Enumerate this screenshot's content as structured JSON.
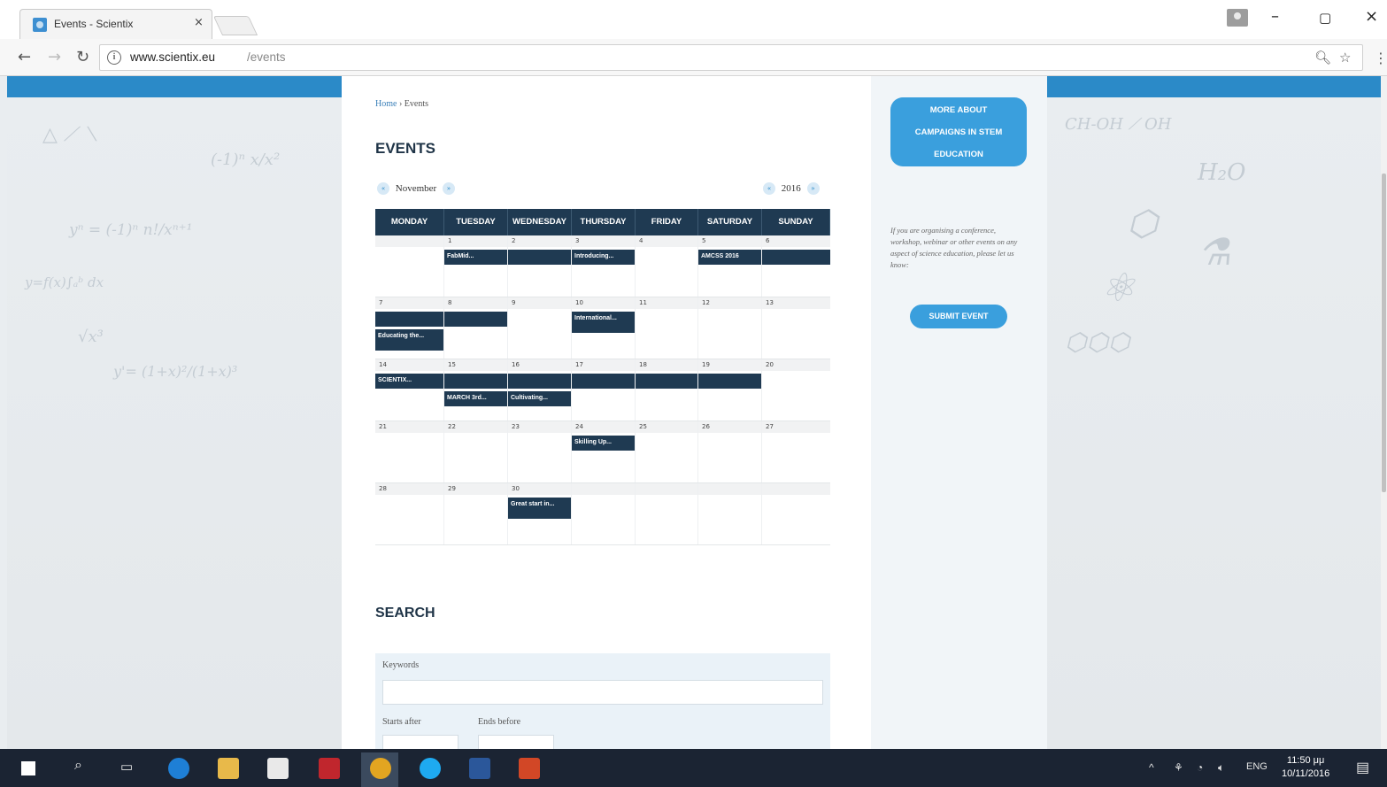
{
  "browser": {
    "tab_title": "Events - Scientix",
    "tab_close": "×",
    "url_domain": "www.scientix.eu",
    "url_path": "/events",
    "win_min": "–",
    "win_max": "▢",
    "win_close": "×"
  },
  "page": {
    "breadcrumb_home": "Home",
    "breadcrumb_sep": " › ",
    "breadcrumb_current": "Events",
    "title": "EVENTS",
    "month": "November",
    "year": "2016",
    "prev": "«",
    "next": "»"
  },
  "calendar": {
    "days": [
      "MONDAY",
      "TUESDAY",
      "WEDNESDAY",
      "THURSDAY",
      "FRIDAY",
      "SATURDAY",
      "SUNDAY"
    ],
    "weeks": [
      [
        {
          "num": "",
          "events": []
        },
        {
          "num": "1",
          "events": [
            "FabMid..."
          ]
        },
        {
          "num": "2",
          "events": [
            ""
          ]
        },
        {
          "num": "3",
          "events": [
            "Introducing..."
          ]
        },
        {
          "num": "4",
          "events": []
        },
        {
          "num": "5",
          "events": [
            "AMCSS 2016"
          ]
        },
        {
          "num": "6",
          "events": [
            ""
          ]
        }
      ],
      [
        {
          "num": "7",
          "events": [
            "",
            "Educating the..."
          ]
        },
        {
          "num": "8",
          "events": [
            ""
          ]
        },
        {
          "num": "9",
          "events": []
        },
        {
          "num": "10",
          "events": [
            "International..."
          ]
        },
        {
          "num": "11",
          "events": []
        },
        {
          "num": "12",
          "events": []
        },
        {
          "num": "13",
          "events": []
        }
      ],
      [
        {
          "num": "14",
          "events": [
            "SCIENTIX..."
          ]
        },
        {
          "num": "15",
          "events": [
            "",
            "MARCH 3rd..."
          ]
        },
        {
          "num": "16",
          "events": [
            "",
            "Cultivating..."
          ]
        },
        {
          "num": "17",
          "events": [
            ""
          ]
        },
        {
          "num": "18",
          "events": [
            ""
          ]
        },
        {
          "num": "19",
          "events": [
            ""
          ]
        },
        {
          "num": "20",
          "events": []
        }
      ],
      [
        {
          "num": "21",
          "events": []
        },
        {
          "num": "22",
          "events": []
        },
        {
          "num": "23",
          "events": []
        },
        {
          "num": "24",
          "events": [
            "Skilling Up..."
          ]
        },
        {
          "num": "25",
          "events": []
        },
        {
          "num": "26",
          "events": []
        },
        {
          "num": "27",
          "events": []
        }
      ],
      [
        {
          "num": "28",
          "events": []
        },
        {
          "num": "29",
          "events": []
        },
        {
          "num": "30",
          "events": [
            "Great start in..."
          ]
        },
        {
          "num": "",
          "events": []
        },
        {
          "num": "",
          "events": []
        },
        {
          "num": "",
          "events": []
        },
        {
          "num": "",
          "events": []
        }
      ]
    ]
  },
  "search": {
    "title": "SEARCH",
    "keywords_label": "Keywords",
    "starts_after_label": "Starts after",
    "ends_before_label": "Ends before"
  },
  "sidebar": {
    "more_button_lines": [
      "MORE ABOUT",
      "CAMPAIGNS IN STEM",
      "EDUCATION"
    ],
    "info_text": "If you are organising a conference, workshop, webinar or other events on any aspect of science education, please let us know:",
    "submit_button": "SUBMIT EVENT"
  },
  "taskbar": {
    "lang": "ENG",
    "time": "11:50 μμ",
    "date": "10/11/2016"
  },
  "colors": {
    "accent_blue": "#2b8ac8",
    "calendar_navy": "#1f3a52",
    "button_blue": "#3a9fdd"
  }
}
